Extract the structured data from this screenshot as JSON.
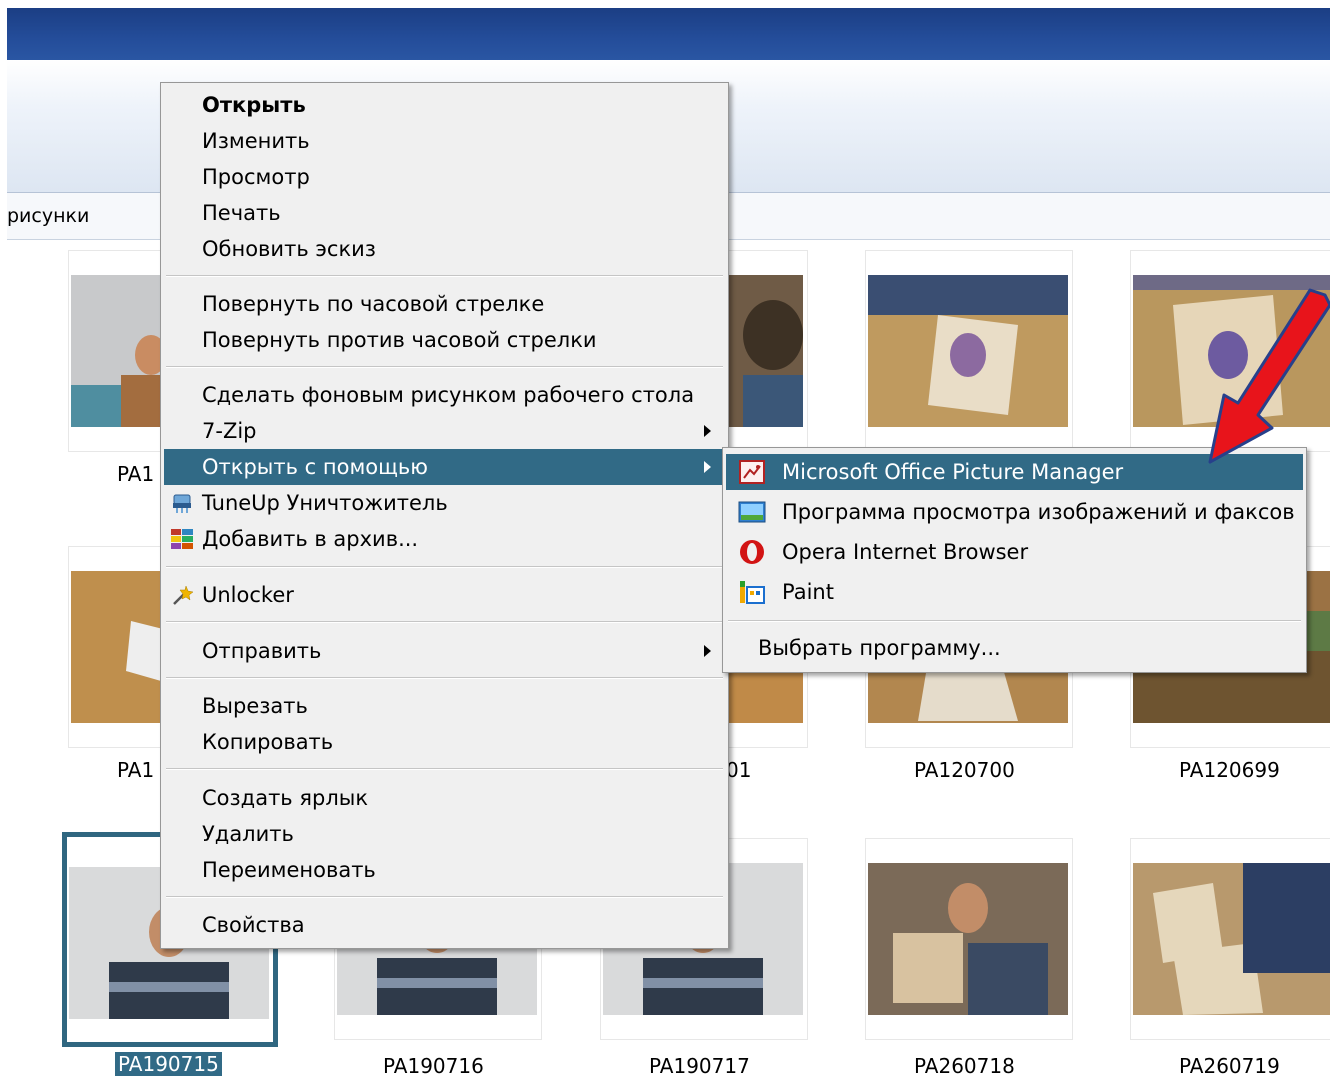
{
  "address": {
    "text": "рисунки"
  },
  "thumbnails": [
    {
      "name": "PA1",
      "caption": "PA1"
    },
    {
      "name": "",
      "caption": ""
    },
    {
      "name": "",
      "caption": ""
    },
    {
      "name": "",
      "caption": ""
    },
    {
      "name": "",
      "caption": ""
    },
    {
      "name": "PA1",
      "caption": "PA1"
    },
    {
      "name": "",
      "caption": "01"
    },
    {
      "name": "",
      "caption": ""
    },
    {
      "name": "PA120700",
      "caption": "PA120700"
    },
    {
      "name": "PA120699",
      "caption": "PA120699"
    },
    {
      "name": "PA190715",
      "caption": "PA190715"
    },
    {
      "name": "PA190716",
      "caption": "PA190716"
    },
    {
      "name": "PA190717",
      "caption": "PA190717"
    },
    {
      "name": "PA260718",
      "caption": "PA260718"
    },
    {
      "name": "PA260719",
      "caption": "PA260719"
    }
  ],
  "context_menu": {
    "open": "Открыть",
    "edit": "Изменить",
    "preview": "Просмотр",
    "print": "Печать",
    "refresh_thumb": "Обновить эскиз",
    "rotate_cw": "Повернуть по часовой стрелке",
    "rotate_ccw": "Повернуть против часовой стрелки",
    "set_wallpaper": "Сделать фоновым рисунком рабочего стола",
    "zip": "7-Zip",
    "open_with": "Открыть с помощью",
    "tuneup": "TuneUp Уничтожитель",
    "add_archive": "Добавить в архив...",
    "unlocker": "Unlocker",
    "send_to": "Отправить",
    "cut": "Вырезать",
    "copy": "Копировать",
    "create_shortcut": "Создать ярлык",
    "delete": "Удалить",
    "rename": "Переименовать",
    "properties": "Свойства"
  },
  "open_with_menu": {
    "picture_manager": "Microsoft Office Picture Manager",
    "image_viewer": "Программа просмотра изображений и факсов",
    "opera": "Opera Internet Browser",
    "paint": "Paint",
    "choose": "Выбрать программу..."
  },
  "colors": {
    "highlight": "#316a86",
    "arrow": "#e8141b",
    "arrow_outline": "#27408b",
    "titlebar": "#244d9a"
  }
}
